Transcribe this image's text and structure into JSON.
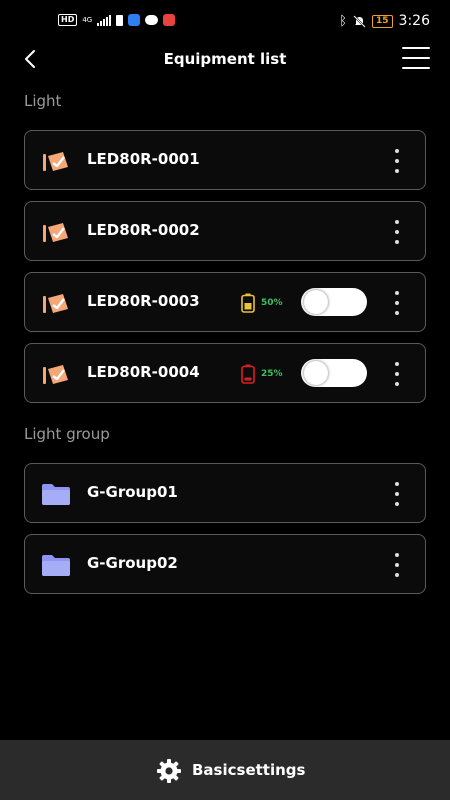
{
  "status_bar": {
    "hd": "HD",
    "network": "4G",
    "battery_level": "15",
    "time": "3:26",
    "battery_color": "#f0a030"
  },
  "header": {
    "title": "Equipment list"
  },
  "sections": {
    "light": {
      "title": "Light"
    },
    "light_group": {
      "title": "Light group"
    }
  },
  "lights": [
    {
      "name": "LED80R-0001"
    },
    {
      "name": "LED80R-0002"
    },
    {
      "name": "LED80R-0003",
      "battery": "50%",
      "battery_color": "#e8c23a",
      "toggle_on": false
    },
    {
      "name": "LED80R-0004",
      "battery": "25%",
      "battery_color": "#d92020",
      "toggle_on": false
    }
  ],
  "groups": [
    {
      "name": "G-Group01"
    },
    {
      "name": "G-Group02"
    }
  ],
  "footer": {
    "label": "Basicsettings"
  },
  "colors": {
    "light_icon": "#f6a777",
    "folder_icon": "#8d95f0",
    "battery_pct_text": "#3fbf5f"
  }
}
